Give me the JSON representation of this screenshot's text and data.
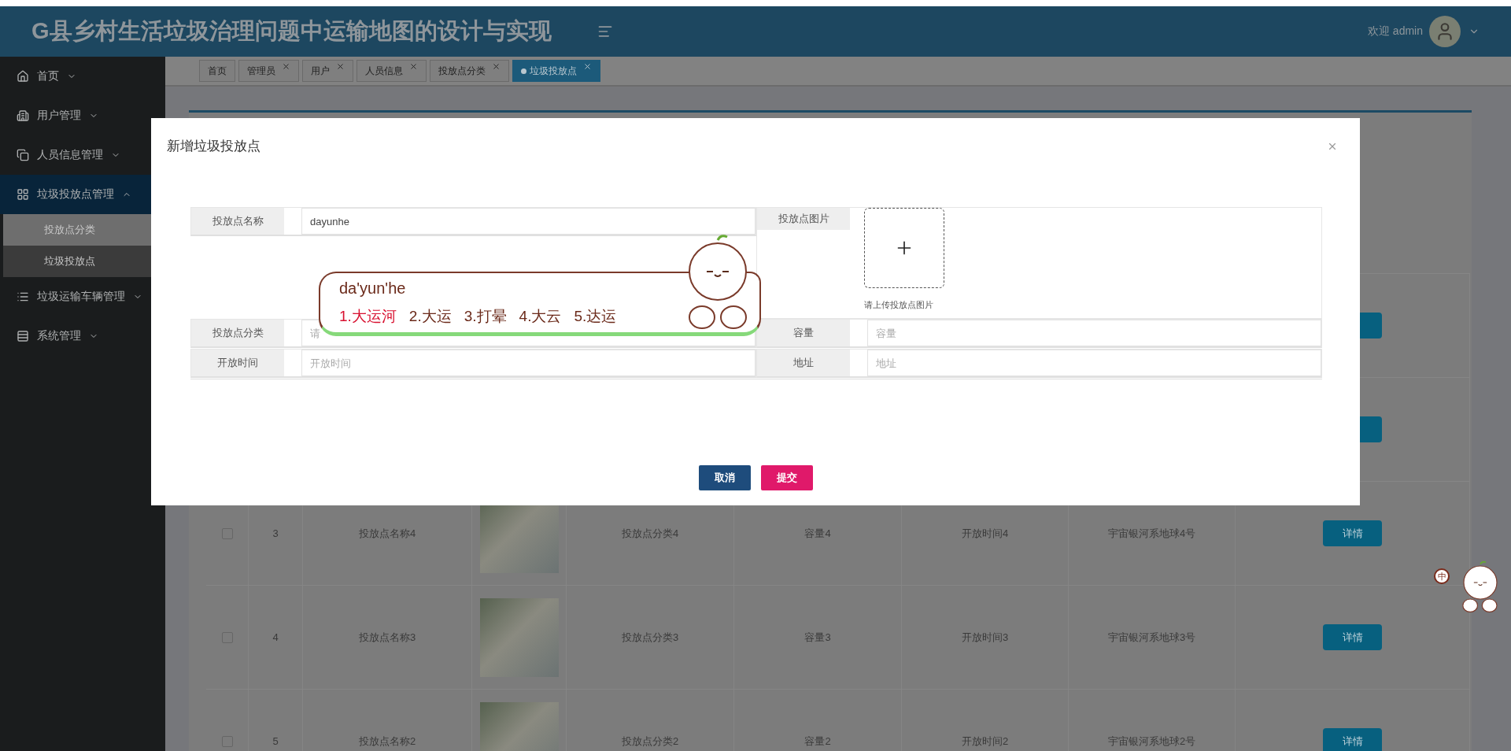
{
  "header": {
    "title": "G县乡村生活垃圾治理问题中运输地图的设计与实现",
    "welcome": "欢迎 admin"
  },
  "sidebar": {
    "items": [
      {
        "label": "首页",
        "selected": false,
        "expanded": false
      },
      {
        "label": "用户管理",
        "selected": false,
        "expanded": false
      },
      {
        "label": "人员信息管理",
        "selected": false,
        "expanded": false
      },
      {
        "label": "垃圾投放点管理",
        "selected": true,
        "expanded": true,
        "children": [
          {
            "label": "投放点分类",
            "selected": false
          },
          {
            "label": "垃圾投放点",
            "selected": true
          }
        ]
      },
      {
        "label": "垃圾运输车辆管理",
        "selected": false,
        "expanded": false
      },
      {
        "label": "系统管理",
        "selected": false,
        "expanded": false
      }
    ]
  },
  "tabs": [
    {
      "label": "首页",
      "closable": false,
      "selected": false
    },
    {
      "label": "管理员",
      "closable": true,
      "selected": false
    },
    {
      "label": "用户",
      "closable": true,
      "selected": false
    },
    {
      "label": "人员信息",
      "closable": true,
      "selected": false
    },
    {
      "label": "投放点分类",
      "closable": true,
      "selected": false
    },
    {
      "label": "垃圾投放点",
      "closable": true,
      "selected": true
    }
  ],
  "table": {
    "rows": [
      {
        "checked": false,
        "index": "3",
        "name": "投放点名称4",
        "category": "投放点分类4",
        "capacity": "容量4",
        "open_time": "开放时间4",
        "address": "宇宙银河系地球4号",
        "action": "详情"
      },
      {
        "checked": false,
        "index": "4",
        "name": "投放点名称3",
        "category": "投放点分类3",
        "capacity": "容量3",
        "open_time": "开放时间3",
        "address": "宇宙银河系地球3号",
        "action": "详情"
      },
      {
        "checked": false,
        "index": "5",
        "name": "投放点名称2",
        "category": "投放点分类2",
        "capacity": "容量2",
        "open_time": "开放时间2",
        "address": "宇宙银河系地球2号",
        "action": "详情"
      }
    ]
  },
  "modal": {
    "title": "新增垃圾投放点",
    "name_field": {
      "label": "投放点名称",
      "value": "dayunhe"
    },
    "image_field": {
      "label": "投放点图片",
      "hint": "请上传投放点图片"
    },
    "left_fields": [
      {
        "label": "投放点分类",
        "placeholder": "请"
      },
      {
        "label": "开放时间",
        "placeholder": "开放时间"
      }
    ],
    "right_fields": [
      {
        "label": "容量",
        "placeholder": "容量"
      },
      {
        "label": "地址",
        "placeholder": "地址"
      }
    ],
    "buttons": [
      {
        "label": "取消",
        "kind": "cancel"
      },
      {
        "label": "提交",
        "kind": "submit"
      }
    ]
  },
  "ime": {
    "composition": "da'yun'he",
    "candidates": [
      {
        "label": "1.大运河",
        "selected": true
      },
      {
        "label": "2.大运",
        "selected": false
      },
      {
        "label": "3.打晕",
        "selected": false
      },
      {
        "label": "4.大云",
        "selected": false
      },
      {
        "label": "5.达运",
        "selected": false
      }
    ],
    "mode": "中"
  }
}
